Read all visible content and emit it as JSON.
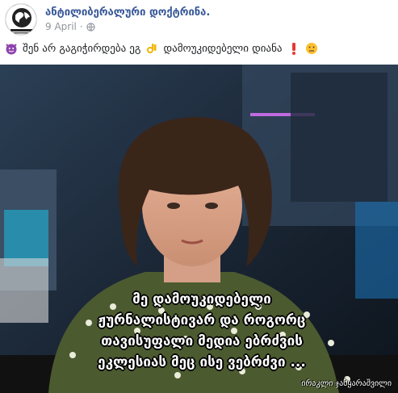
{
  "post": {
    "page_name": "ანტილიბერალური დოქტრინა.",
    "date": "9 April",
    "date_separator": "·",
    "privacy_icon": "globe-icon",
    "avatar_icon": "globe-logo-icon",
    "caption_text": "შენ არ გაგიჭირდება ეგ",
    "caption_text_2": "დამოუკიდებელი დიანა",
    "caption_icons": [
      "devil-emoji-icon",
      "ok-hand-emoji-icon",
      "exclamation-emoji-icon",
      "neutral-face-emoji-icon"
    ]
  },
  "image": {
    "quote_lines": [
      "მე დამოუკიდებელი",
      "ჟურნალისტივარ და როგორც",
      "თავისუფალი მედია ებრძვის",
      "ეკლესიას მეც ისე ვებრძვი ..."
    ],
    "signature": "ირაკლი ჯანყარაშვილი"
  },
  "colors": {
    "link": "#385898",
    "meta": "#90949c",
    "text": "#1c1e21"
  }
}
